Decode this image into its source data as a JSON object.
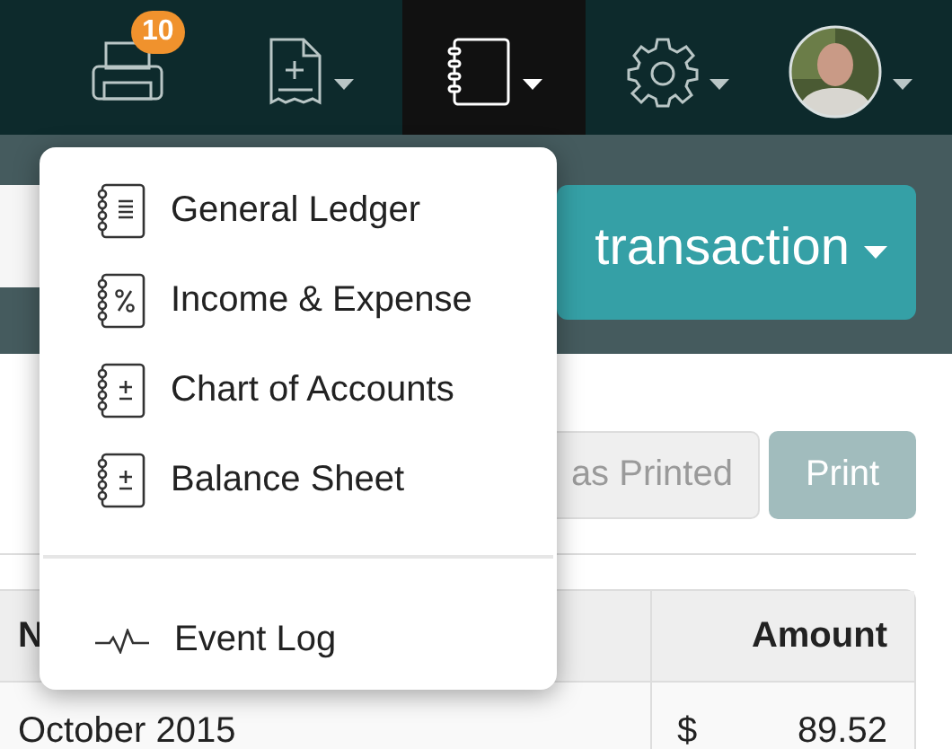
{
  "navbar": {
    "items": [
      {
        "kind": "printer",
        "selected": false,
        "caret": false,
        "badge": "10"
      },
      {
        "kind": "new-document",
        "selected": false,
        "caret": true
      },
      {
        "kind": "notebook",
        "selected": true,
        "caret": true
      },
      {
        "kind": "gear",
        "selected": false,
        "caret": true
      },
      {
        "kind": "avatar",
        "selected": false,
        "caret": true
      }
    ]
  },
  "action_bar": {
    "button": {
      "label": "transaction",
      "caret": true
    }
  },
  "menu": {
    "sections": [
      {
        "items": [
          {
            "kind": "ledger-lines",
            "label": "General Ledger"
          },
          {
            "kind": "ledger-percent",
            "label": "Income & Expense"
          },
          {
            "kind": "ledger-plusminus",
            "label": "Chart of Accounts"
          },
          {
            "kind": "ledger-plusminus",
            "label": "Balance Sheet"
          }
        ]
      },
      {
        "items": [
          {
            "kind": "pulse",
            "label": "Event Log"
          }
        ]
      }
    ]
  },
  "buttons": [
    {
      "label": "as Printed",
      "kind": "secondary"
    },
    {
      "label": "Print",
      "kind": "primary"
    }
  ],
  "table": {
    "columns": [
      {
        "label": "N"
      },
      {
        "label": "Amount"
      }
    ],
    "rows": [
      {
        "name": "October 2015",
        "currency": "$",
        "amount": "89.52"
      }
    ]
  }
}
